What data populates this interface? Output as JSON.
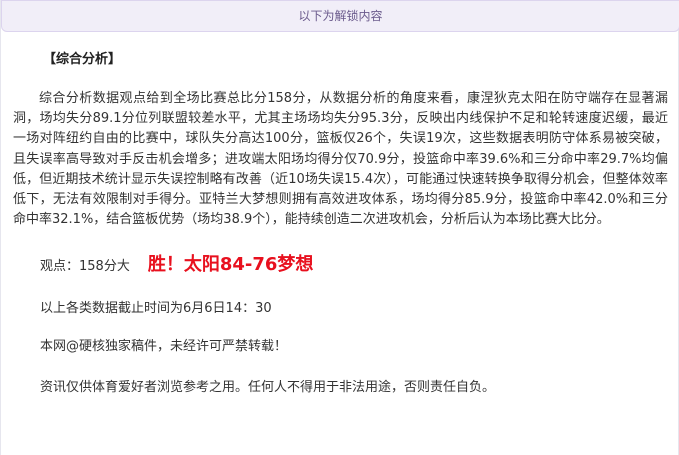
{
  "header": {
    "unlock_label": "以下为解锁内容"
  },
  "article": {
    "section_title": "【综合分析】",
    "analysis_text": "综合分析数据观点给到全场比赛总比分158分，从数据分析的角度来看，康涅狄克太阳在防守端存在显著漏洞，场均失分89.1分位列联盟较差水平，尤其主场场均失分95.3分，反映出内线保护不足和轮转速度迟缓，最近一场对阵纽约自由的比赛中，球队失分高达100分，篮板仅26个，失误19次，这些数据表明防守体系易被突破，且失误率高导致对手反击机会增多；进攻端太阳场均得分仅70.9分，投篮命中率39.6%和三分命中率29.7%均偏低，但近期技术统计显示失误控制略有改善（近10场失误15.4次），可能通过快速转换争取得分机会，但整体效率低下，无法有效限制对手得分。亚特兰大梦想则拥有高效进攻体系，场均得分85.9分，投篮命中率42.0%和三分命中率32.1%，结合篮板优势（场均38.9个），能持续创造二次进攻机会，分析后认为本场比赛大比分。",
    "viewpoint": "观点：158分大",
    "result": "胜！太阳84-76梦想",
    "data_cutoff": "以上各类数据截止时间为6月6日14：30",
    "copyright": "本网@硬核独家稿件，未经许可严禁转载！",
    "disclaimer": "资讯仅供体育爱好者浏览参考之用。任何人不得用于非法用途，否则责任自负。"
  },
  "colors": {
    "result_red": "#e8101e",
    "unlock_bar_bg": "#f1eef8",
    "unlock_bar_text": "#6a5a8c",
    "body_text": "#333333"
  }
}
